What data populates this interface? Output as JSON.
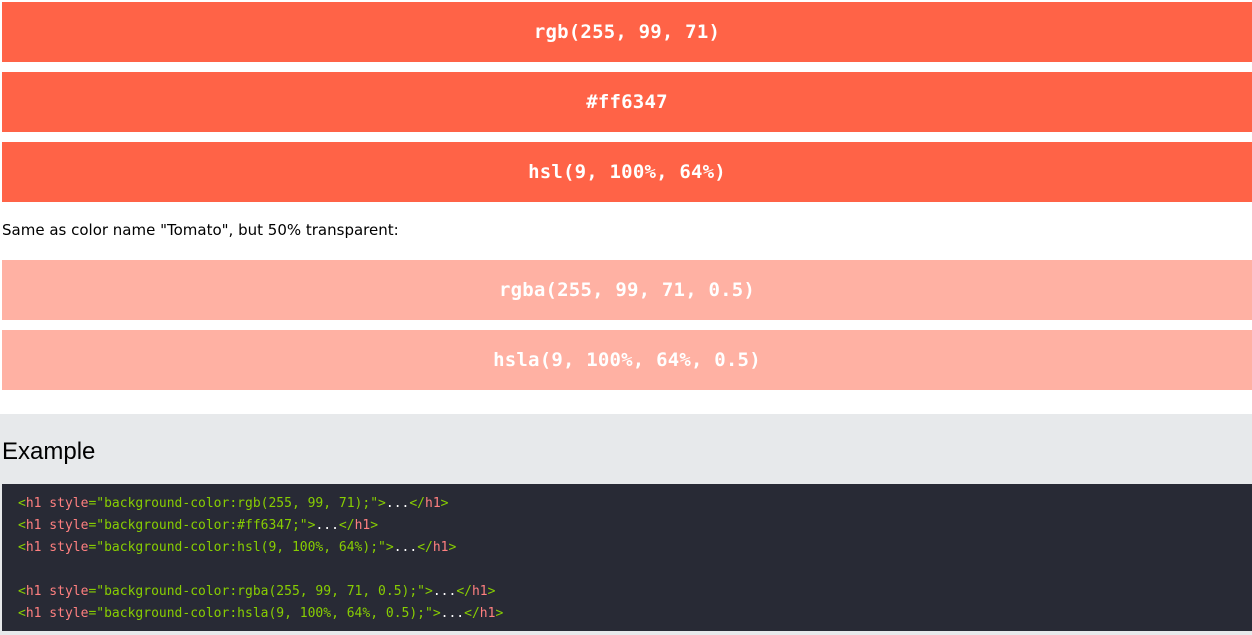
{
  "swatches": {
    "solid": [
      {
        "label": "rgb(255, 99, 71)"
      },
      {
        "label": "#ff6347"
      },
      {
        "label": "hsl(9, 100%, 64%)"
      }
    ],
    "note": "Same as color name \"Tomato\", but 50% transparent:",
    "translucent": [
      {
        "label": "rgba(255, 99, 71, 0.5)"
      },
      {
        "label": "hsla(9, 100%, 64%, 0.5)"
      }
    ]
  },
  "example": {
    "heading": "Example",
    "code_lines": [
      {
        "open_lt": "<",
        "tag": "h1",
        "attr": " style",
        "eq": "=",
        "value": "\"background-color:rgb(255, 99, 71);\"",
        "gt": ">",
        "text": "...",
        "close_lt": "</",
        "close_tag": "h1",
        "close_gt": ">"
      },
      {
        "open_lt": "<",
        "tag": "h1",
        "attr": " style",
        "eq": "=",
        "value": "\"background-color:#ff6347;\"",
        "gt": ">",
        "text": "...",
        "close_lt": "</",
        "close_tag": "h1",
        "close_gt": ">"
      },
      {
        "open_lt": "<",
        "tag": "h1",
        "attr": " style",
        "eq": "=",
        "value": "\"background-color:hsl(9, 100%, 64%);\"",
        "gt": ">",
        "text": "...",
        "close_lt": "</",
        "close_tag": "h1",
        "close_gt": ">"
      },
      {
        "open_lt": "",
        "tag": "",
        "attr": "",
        "eq": "",
        "value": "",
        "gt": "",
        "text": "",
        "close_lt": "",
        "close_tag": "",
        "close_gt": ""
      },
      {
        "open_lt": "<",
        "tag": "h1",
        "attr": " style",
        "eq": "=",
        "value": "\"background-color:rgba(255, 99, 71, 0.5);\"",
        "gt": ">",
        "text": "...",
        "close_lt": "</",
        "close_tag": "h1",
        "close_gt": ">"
      },
      {
        "open_lt": "<",
        "tag": "h1",
        "attr": " style",
        "eq": "=",
        "value": "\"background-color:hsla(9, 100%, 64%, 0.5);\"",
        "gt": ">",
        "text": "...",
        "close_lt": "</",
        "close_tag": "h1",
        "close_gt": ">"
      }
    ]
  },
  "colors": {
    "tomato": "#ff6347",
    "tomato_half": "rgba(255, 99, 71, 0.5)",
    "example_panel_bg": "#e7e9eb",
    "code_bg": "#282a35"
  }
}
